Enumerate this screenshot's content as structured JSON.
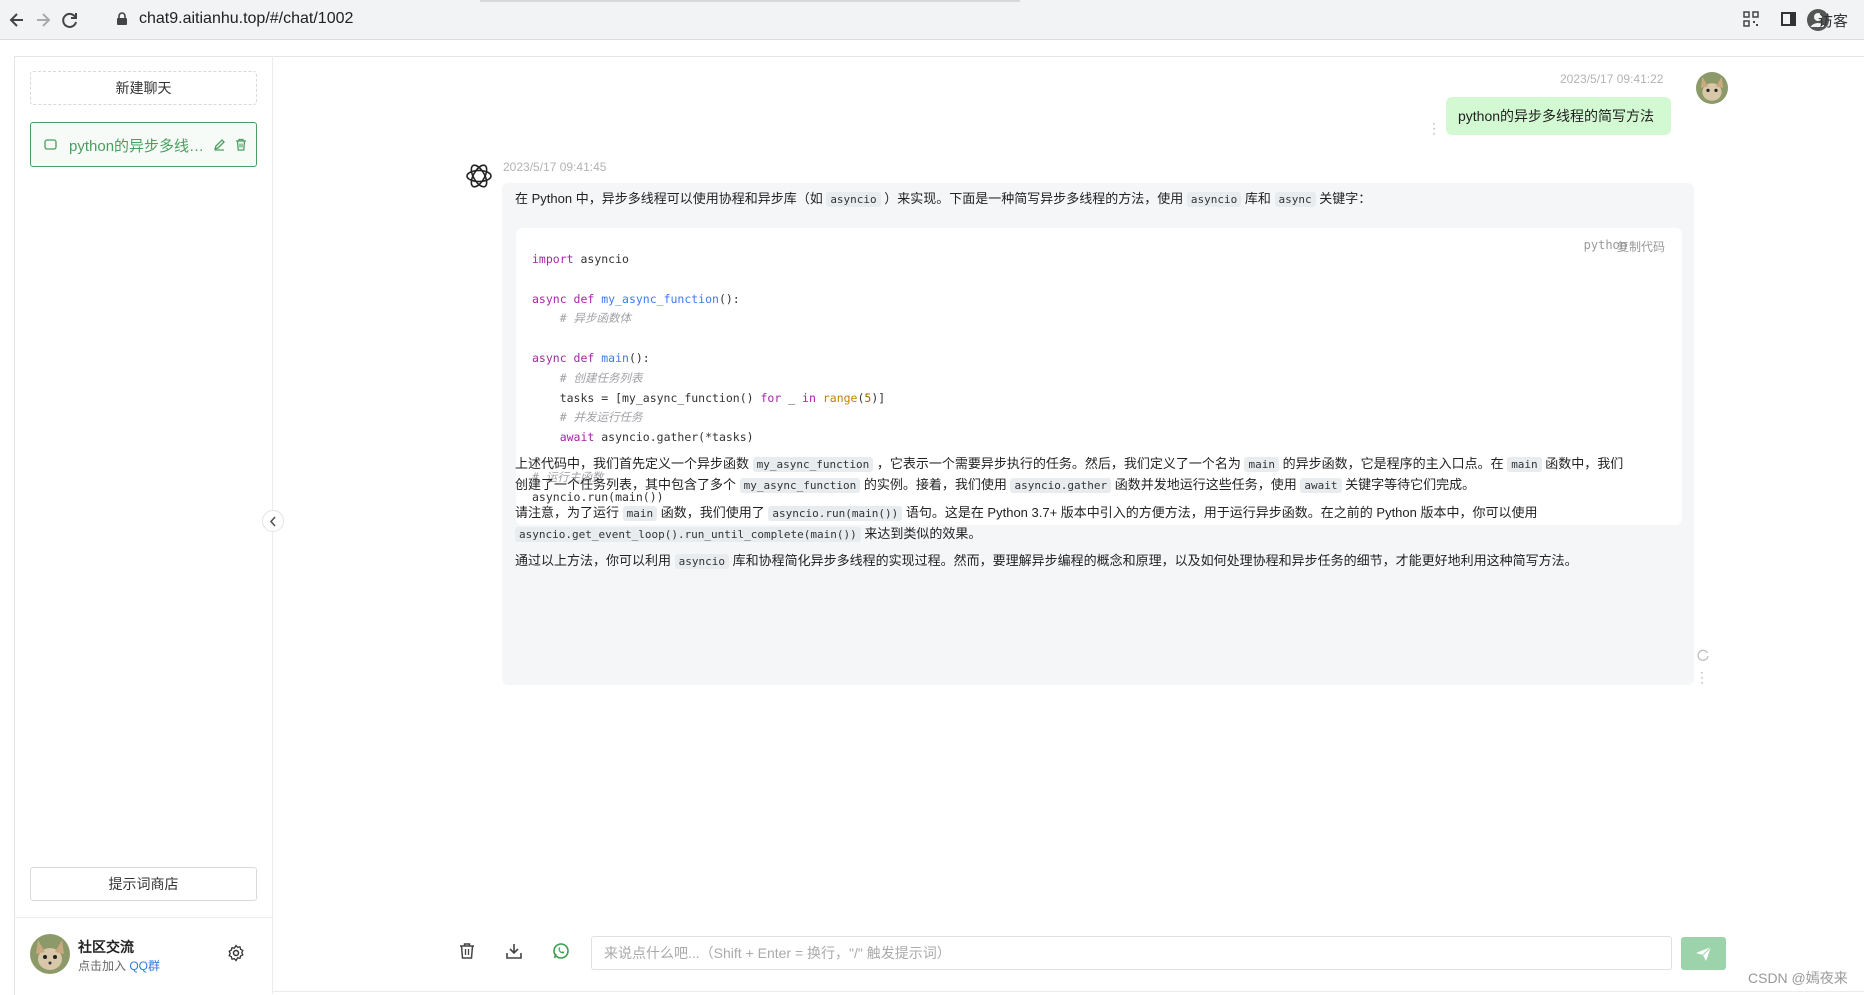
{
  "browser": {
    "url": "chat9.aitianhu.top/#/chat/1002",
    "visitor_label": "访客"
  },
  "sidebar": {
    "new_chat_label": "新建聊天",
    "chats": [
      {
        "title": "python的异步多线程的简写方法"
      }
    ],
    "prompt_store_label": "提示词商店",
    "footer": {
      "title": "社区交流",
      "subtitle_prefix": "点击加入 ",
      "subtitle_link": "QQ群"
    }
  },
  "conversation": {
    "user_message": {
      "time": "2023/5/17 09:41:22",
      "text": "python的异步多线程的简写方法"
    },
    "bot_message": {
      "time": "2023/5/17 09:41:45",
      "intro": {
        "t1": "在 Python 中，异步多线程可以使用协程和异步库（如 ",
        "c1": "asyncio",
        "t2": " ）来实现。下面是一种简写异步多线程的方法，使用 ",
        "c2": "asyncio",
        "t3": " 库和 ",
        "c3": "async",
        "t4": " 关键字："
      },
      "code_block": {
        "language": "python",
        "copy_label": "复制代码"
      },
      "para2": {
        "t1": "上述代码中，我们首先定义一个异步函数 ",
        "c1": "my_async_function",
        "t2": " ，它表示一个需要异步执行的任务。然后，我们定义了一个名为 ",
        "c2": "main",
        "t3": " 的异步函数，它是程序的主入口点。在 ",
        "c3": "main",
        "t4": " 函数中，我们",
        "t5": "创建了一个任务列表，其中包含了多个 ",
        "c4": "my_async_function",
        "t6": " 的实例。接着，我们使用 ",
        "c5": "asyncio.gather",
        "t7": " 函数并发地运行这些任务，使用 ",
        "c6": "await",
        "t8": " 关键字等待它们完成。"
      },
      "para3": {
        "t1": "请注意，为了运行 ",
        "c1": "main",
        "t2": " 函数，我们使用了 ",
        "c2": "asyncio.run(main())",
        "t3": " 语句。这是在 Python 3.7+ 版本中引入的方便方法，用于运行异步函数。在之前的 Python 版本中，你可以使用",
        "c3": "asyncio.get_event_loop().run_until_complete(main())",
        "t4": " 来达到类似的效果。"
      },
      "para4": {
        "t1": "通过以上方法，你可以利用 ",
        "c1": "asyncio",
        "t2": " 库和协程简化异步多线程的实现过程。然而，要理解异步编程的概念和原理，以及如何处理协程和异步任务的细节，才能更好地利用这种简写方法。"
      }
    }
  },
  "code": {
    "l1a": "import",
    "l1b": " asyncio",
    "l3a": "async",
    "l3b": " def",
    "l3c": " my_async_function",
    "l3d": "():",
    "l4": "    # 异步函数体",
    "l6a": "async",
    "l6b": " def",
    "l6c": " main",
    "l6d": "():",
    "l7": "    # 创建任务列表",
    "l8a": "    tasks = [my_async_function() ",
    "l8b": "for",
    "l8c": " _ ",
    "l8d": "in",
    "l8e": " ",
    "l8f": "range",
    "l8g": "(",
    "l8h": "5",
    "l8i": ")]",
    "l9": "    # 并发运行任务",
    "l10a": "    ",
    "l10b": "await",
    "l10c": " asyncio.gather(*tasks)",
    "l12": "# 运行主函数",
    "l13": "asyncio.run(main())"
  },
  "input": {
    "placeholder": "来说点什么吧...（Shift + Enter = 换行，\"/\" 触发提示词）"
  },
  "watermark": "CSDN @嫣夜来",
  "colors": {
    "accent_green": "#4b9e5f",
    "user_bubble": "#d2f9d1",
    "bot_bubble": "#f4f6f8",
    "send_button": "#9cd3ab"
  }
}
